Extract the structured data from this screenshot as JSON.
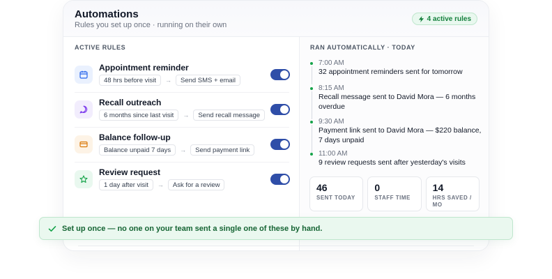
{
  "header": {
    "title": "Automations",
    "subtitle": "Rules you set up once · running on their own",
    "badge": "4 active rules"
  },
  "active_rules": {
    "label": "ACTIVE RULES",
    "items": [
      {
        "name": "Appointment reminder",
        "trigger": "48 hrs before visit",
        "action": "Send SMS + email",
        "icon": "calendar-icon",
        "enabled": true
      },
      {
        "name": "Recall outreach",
        "trigger": "6 months since last visit",
        "action": "Send recall message",
        "icon": "message-icon",
        "enabled": true
      },
      {
        "name": "Balance follow-up",
        "trigger": "Balance unpaid 7 days",
        "action": "Send payment link",
        "icon": "credit-card-icon",
        "enabled": true
      },
      {
        "name": "Review request",
        "trigger": "1 day after visit",
        "action": "Ask for a review",
        "icon": "star-icon",
        "enabled": true
      }
    ]
  },
  "activity": {
    "label": "RAN AUTOMATICALLY · TODAY",
    "events": [
      {
        "time": "7:00 AM",
        "text": "32 appointment reminders sent for tomorrow"
      },
      {
        "time": "8:15 AM",
        "text": "Recall message sent to David Mora — 6 months overdue"
      },
      {
        "time": "9:30 AM",
        "text": "Payment link sent to David Mora — $220 balance, 7 days unpaid"
      },
      {
        "time": "11:00 AM",
        "text": "9 review requests sent after yesterday's visits"
      }
    ]
  },
  "stats": [
    {
      "value": "46",
      "label": "SENT TODAY"
    },
    {
      "value": "0",
      "label": "STAFF TIME"
    },
    {
      "value": "14",
      "label": "HRS SAVED / MO"
    }
  ],
  "banner": {
    "text": "Set up once — no one on your team sent a single one of these by hand."
  },
  "colors": {
    "accent": "#2f4ea8",
    "success": "#16a34a",
    "success_bg": "#eaf8ef",
    "success_text": "#166534"
  }
}
